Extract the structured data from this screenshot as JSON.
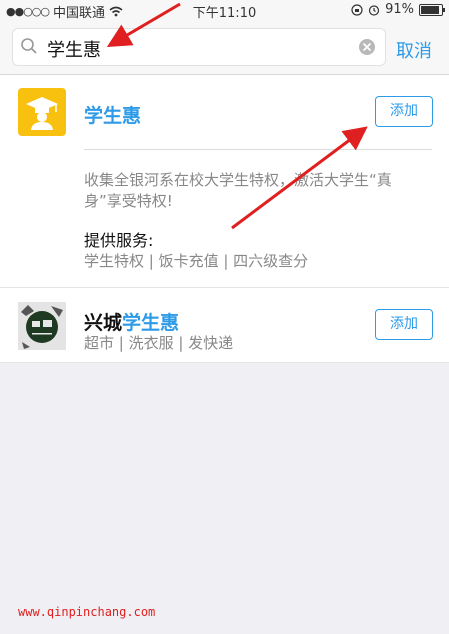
{
  "status_bar": {
    "signal_dots": "●●○○○",
    "carrier": "中国联通",
    "time": "下午11:10",
    "battery_text": "91%",
    "battery_level": 0.91
  },
  "search": {
    "query": "学生惠",
    "cancel_label": "取消"
  },
  "results": [
    {
      "name": "学生惠",
      "add_label": "添加",
      "description": "收集全银河系在校大学生特权，激活大学生“真身”享受特权!",
      "services_label": "提供服务:",
      "services": "学生特权 | 饭卡充值 | 四六级查分"
    },
    {
      "name_prefix": "兴城",
      "name_highlight": "学生惠",
      "add_label": "添加",
      "tags": "超市 | 洗衣服 | 发快递"
    }
  ],
  "watermark": "www.qinpinchang.com",
  "colors": {
    "accent": "#2e9be8",
    "app_icon_1": "#f8c10f",
    "annotation_arrow": "#e02020"
  }
}
